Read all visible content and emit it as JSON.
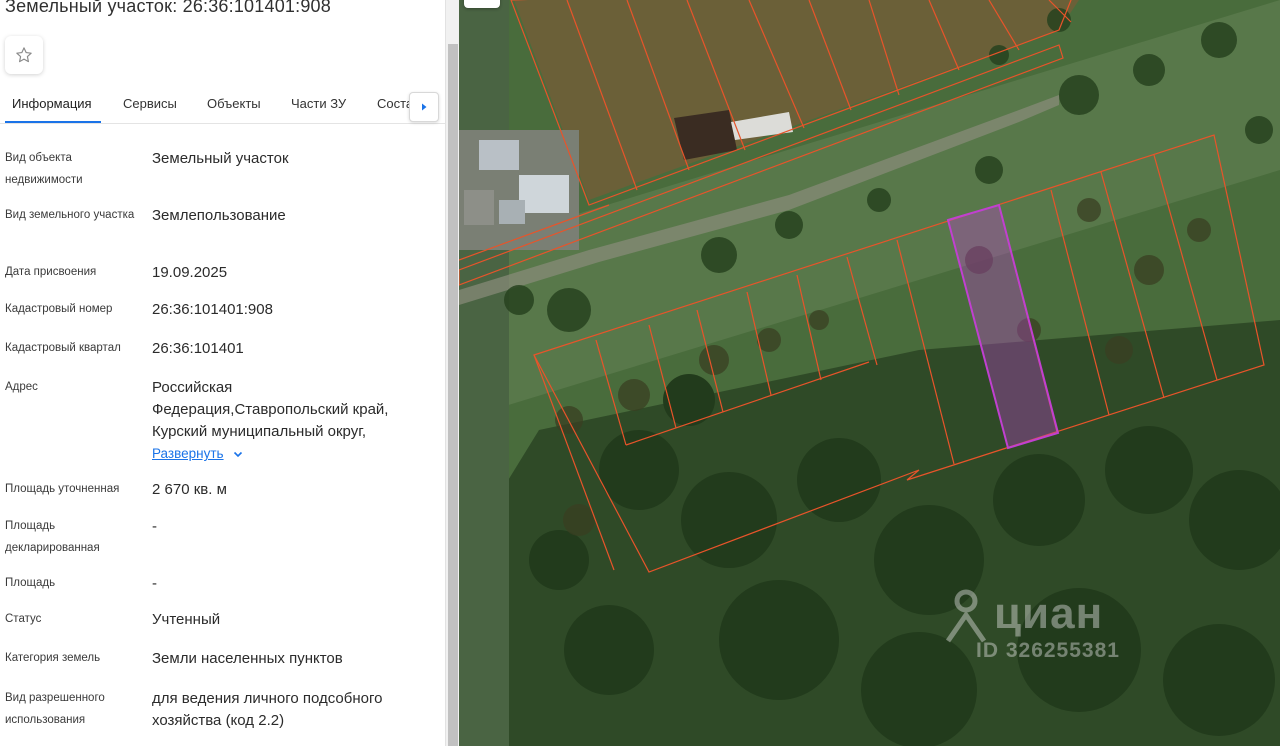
{
  "panel": {
    "title": "Земельный участок: 26:36:101401:908",
    "tabs": [
      {
        "label": "Информация",
        "active": true
      },
      {
        "label": "Сервисы"
      },
      {
        "label": "Объекты"
      },
      {
        "label": "Части ЗУ"
      },
      {
        "label": "Соста"
      }
    ],
    "rows": [
      {
        "label": "Вид объекта недвижимости",
        "value": "Земельный участок"
      },
      {
        "label": "Вид земельного участка",
        "value": "Землепользование"
      },
      {
        "label": "Дата присвоения",
        "value": "19.09.2025"
      },
      {
        "label": "Кадастровый номер",
        "value": "26:36:101401:908"
      },
      {
        "label": "Кадастровый квартал",
        "value": "26:36:101401"
      },
      {
        "label": "Адрес",
        "value": "Российская Федерация,Ставропольский край, Курский муниципальный округ,",
        "action": "Развернуть"
      },
      {
        "label": "Площадь уточненная",
        "value": "2 670 кв. м"
      },
      {
        "label": "Площадь декларированная",
        "value": "-"
      },
      {
        "label": "Площадь",
        "value": "-"
      },
      {
        "label": "Статус",
        "value": "Учтенный"
      },
      {
        "label": "Категория земель",
        "value": "Земли населенных пунктов"
      },
      {
        "label": "Вид разрешенного использования",
        "value": "для ведения личного подсобного хозяйства (код 2.2)"
      }
    ]
  },
  "map": {
    "watermark_brand": "циан",
    "watermark_id": "ID 326255381",
    "parcel_outline_color": "#e8542a",
    "selected_parcel_color": "#c040d0"
  },
  "icons": {
    "favorite": "star-outline-icon",
    "tabs_next": "caret-right-icon",
    "expand": "chevron-down-icon"
  }
}
